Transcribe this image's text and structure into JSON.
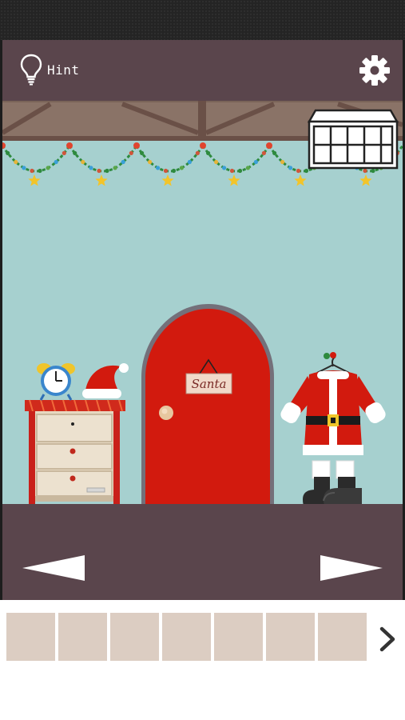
{
  "header": {
    "hint_label": "Hint",
    "hint_icon": "lightbulb-icon",
    "settings_icon": "gear-icon"
  },
  "scene": {
    "door_sign": "Santa",
    "items": [
      "window",
      "christmas-garland",
      "alarm-clock",
      "santa-hat",
      "nightstand",
      "red-door",
      "santa-suit",
      "boots"
    ]
  },
  "navigation": {
    "left_icon": "arrow-left-icon",
    "right_icon": "arrow-right-icon"
  },
  "inventory": {
    "slot_count": 7,
    "next_icon": "chevron-right-icon"
  },
  "colors": {
    "header": "#5a454c",
    "wall": "#a6d0cf",
    "beam": "#8a7367",
    "door": "#d21a0e",
    "slot": "#dccdc2"
  }
}
